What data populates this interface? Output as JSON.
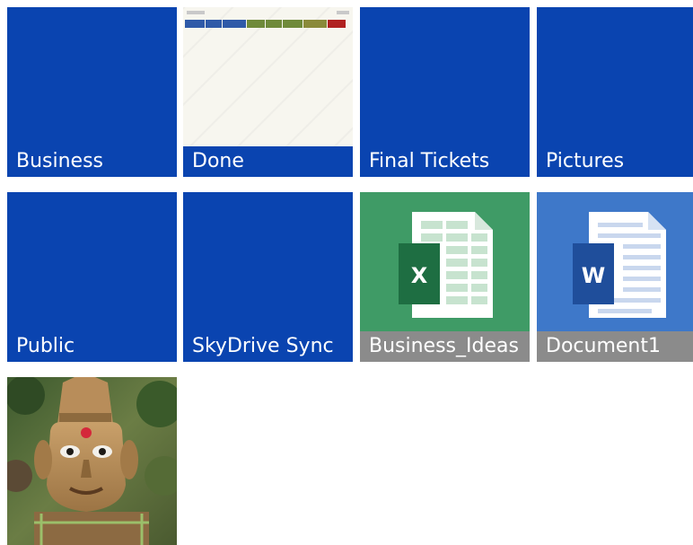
{
  "tiles": [
    {
      "name": "Business",
      "kind": "folder"
    },
    {
      "name": "Done",
      "kind": "folder-thumbnail"
    },
    {
      "name": "Final Tickets",
      "kind": "folder"
    },
    {
      "name": "Pictures",
      "kind": "folder"
    },
    {
      "name": "Public",
      "kind": "folder"
    },
    {
      "name": "SkyDrive Sync",
      "kind": "folder"
    },
    {
      "name": "Business_Ideas",
      "kind": "excel",
      "badge": "X"
    },
    {
      "name": "Document1",
      "kind": "word",
      "badge": "W"
    },
    {
      "name": "",
      "kind": "photo"
    }
  ],
  "colors": {
    "folder": "#0a44b0",
    "excel": "#3f9b66",
    "word": "#3e78c9",
    "label_bar": "#8b8b8b"
  }
}
